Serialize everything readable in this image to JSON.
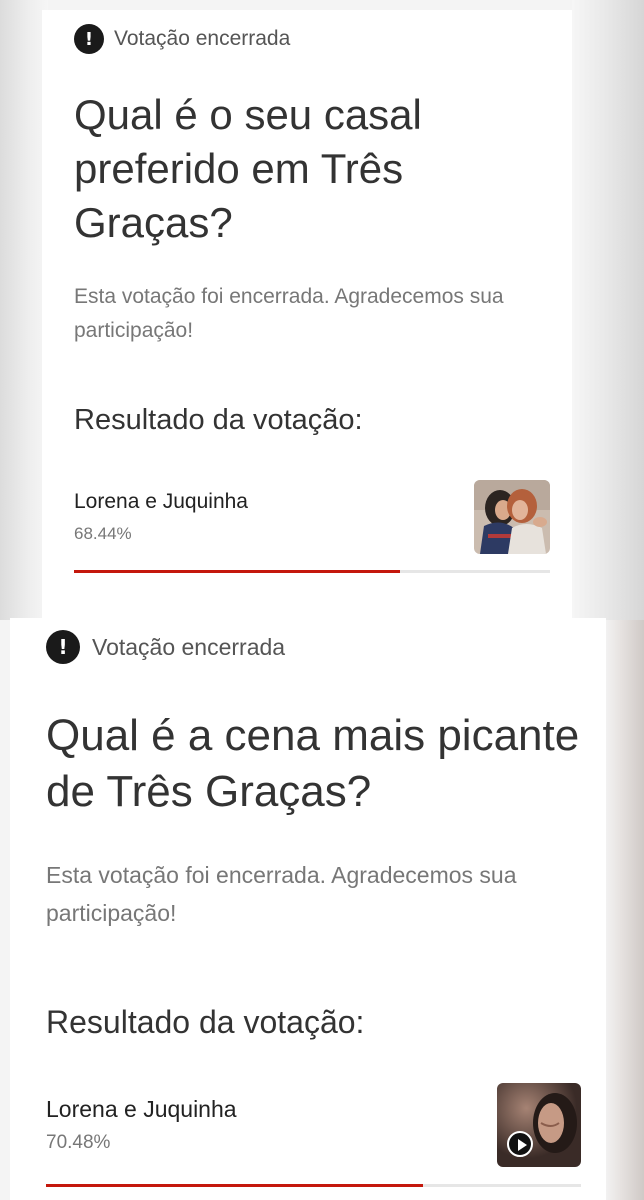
{
  "polls": [
    {
      "status": {
        "icon": "exclamation-icon",
        "glyph": "!",
        "text": "Votação encerrada"
      },
      "question": "Qual é o seu casal preferido em Três Graças?",
      "message": "Esta votação foi encerrada. Agradecemos sua participação!",
      "results_heading": "Resultado da votação:",
      "result": {
        "option": "Lorena e Juquinha",
        "percent_text": "68.44%",
        "percent": 68.44,
        "media": "photo-thumbnail"
      }
    },
    {
      "status": {
        "icon": "exclamation-icon",
        "glyph": "!",
        "text": "Votação encerrada"
      },
      "question": "Qual é a cena mais picante de Três Graças?",
      "message": "Esta votação foi encerrada. Agradecemos sua participação!",
      "results_heading": "Resultado da votação:",
      "result": {
        "option": "Lorena e Juquinha",
        "percent_text": "70.48%",
        "percent": 70.48,
        "media": "video-thumbnail"
      }
    }
  ],
  "colors": {
    "accent": "#c4170c",
    "track": "#e6e6e6",
    "text": "#333333",
    "muted": "#777777"
  }
}
